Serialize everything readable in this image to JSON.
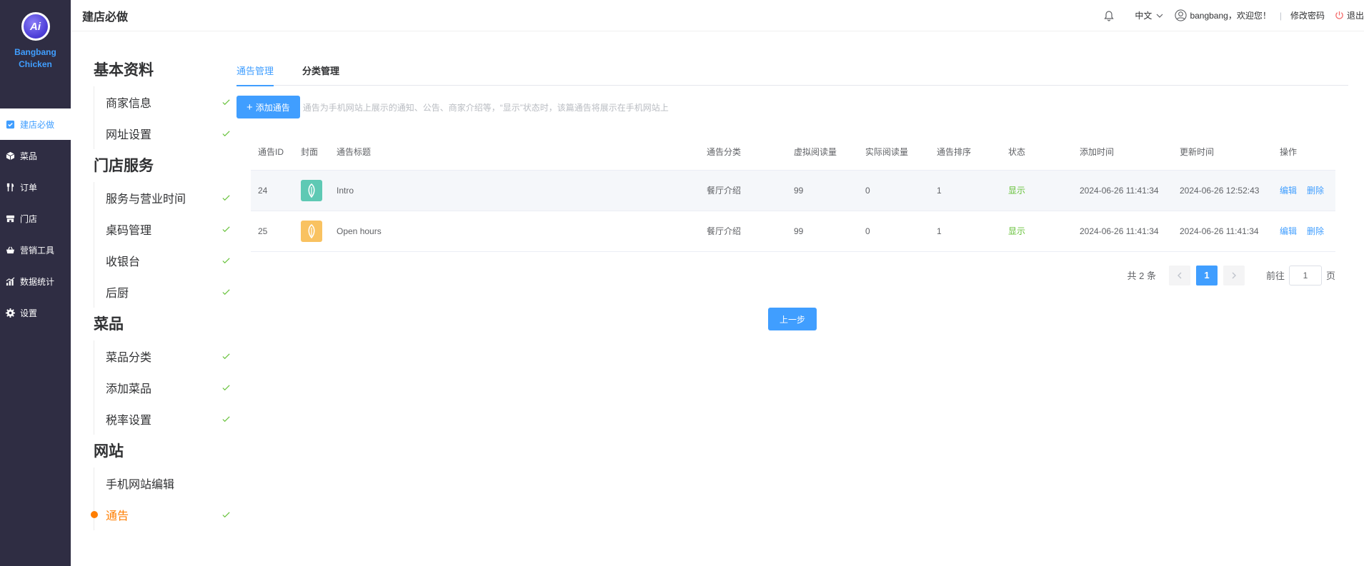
{
  "brand": {
    "name": "Bangbang Chicken",
    "line1": "Bangbang",
    "line2": "Chicken",
    "logo_text": "Ai"
  },
  "nav": [
    {
      "label": "建店必做",
      "icon": "check-square-icon",
      "active": true
    },
    {
      "label": "菜品",
      "icon": "box-icon"
    },
    {
      "label": "订单",
      "icon": "fork-knife-icon"
    },
    {
      "label": "门店",
      "icon": "store-icon"
    },
    {
      "label": "营销工具",
      "icon": "basket-icon"
    },
    {
      "label": "数据统计",
      "icon": "chart-icon"
    },
    {
      "label": "设置",
      "icon": "gear-icon"
    }
  ],
  "header": {
    "title": "建店必做",
    "language": "中文",
    "user_greeting": "bangbang，欢迎您！",
    "separator": "|",
    "change_password": "修改密码",
    "logout": "退出"
  },
  "steps": [
    {
      "title": "基本资料",
      "items": [
        {
          "label": "商家信息",
          "done": true
        },
        {
          "label": "网址设置",
          "done": true
        }
      ]
    },
    {
      "title": "门店服务",
      "items": [
        {
          "label": "服务与营业时间",
          "done": true
        },
        {
          "label": "桌码管理",
          "done": true
        },
        {
          "label": "收银台",
          "done": true
        },
        {
          "label": "后厨",
          "done": true
        }
      ]
    },
    {
      "title": "菜品",
      "items": [
        {
          "label": "菜品分类",
          "done": true
        },
        {
          "label": "添加菜品",
          "done": true
        },
        {
          "label": "税率设置",
          "done": true
        }
      ]
    },
    {
      "title": "网站",
      "items": [
        {
          "label": "手机网站编辑",
          "done": false
        },
        {
          "label": "通告",
          "done": true,
          "current": true
        }
      ]
    }
  ],
  "tabs": [
    {
      "label": "通告管理",
      "active": true
    },
    {
      "label": "分类管理",
      "active": false
    }
  ],
  "toolbar": {
    "add_label": "添加通告",
    "hint": "通告为手机网站上展示的通知、公告、商家介绍等，“显示”状态时，该篇通告将展示在手机网站上"
  },
  "table": {
    "columns": [
      "通告ID",
      "封面",
      "通告标题",
      "通告分类",
      "虚拟阅读量",
      "实际阅读量",
      "通告排序",
      "状态",
      "添加时间",
      "更新时间",
      "操作"
    ],
    "rows": [
      {
        "id": "24",
        "cover_color": "#5ec9b4",
        "title": "Intro",
        "category": "餐厅介绍",
        "virtual_reads": "99",
        "actual_reads": "0",
        "order": "1",
        "status": "显示",
        "added": "2024-06-26 11:41:34",
        "updated": "2024-06-26 12:52:43",
        "edit": "编辑",
        "delete": "删除"
      },
      {
        "id": "25",
        "cover_color": "#f9c261",
        "title": "Open hours",
        "category": "餐厅介绍",
        "virtual_reads": "99",
        "actual_reads": "0",
        "order": "1",
        "status": "显示",
        "added": "2024-06-26 11:41:34",
        "updated": "2024-06-26 11:41:34",
        "edit": "编辑",
        "delete": "删除"
      }
    ]
  },
  "pagination": {
    "total": "共 2 条",
    "current": "1",
    "goto_label": "前往",
    "goto_value": "1",
    "page_suffix": "页"
  },
  "prev_step_label": "上一步",
  "colors": {
    "primary": "#409eff",
    "sidebar": "#2f2d43",
    "current_step": "#ff7e00",
    "success": "#67c23a"
  }
}
